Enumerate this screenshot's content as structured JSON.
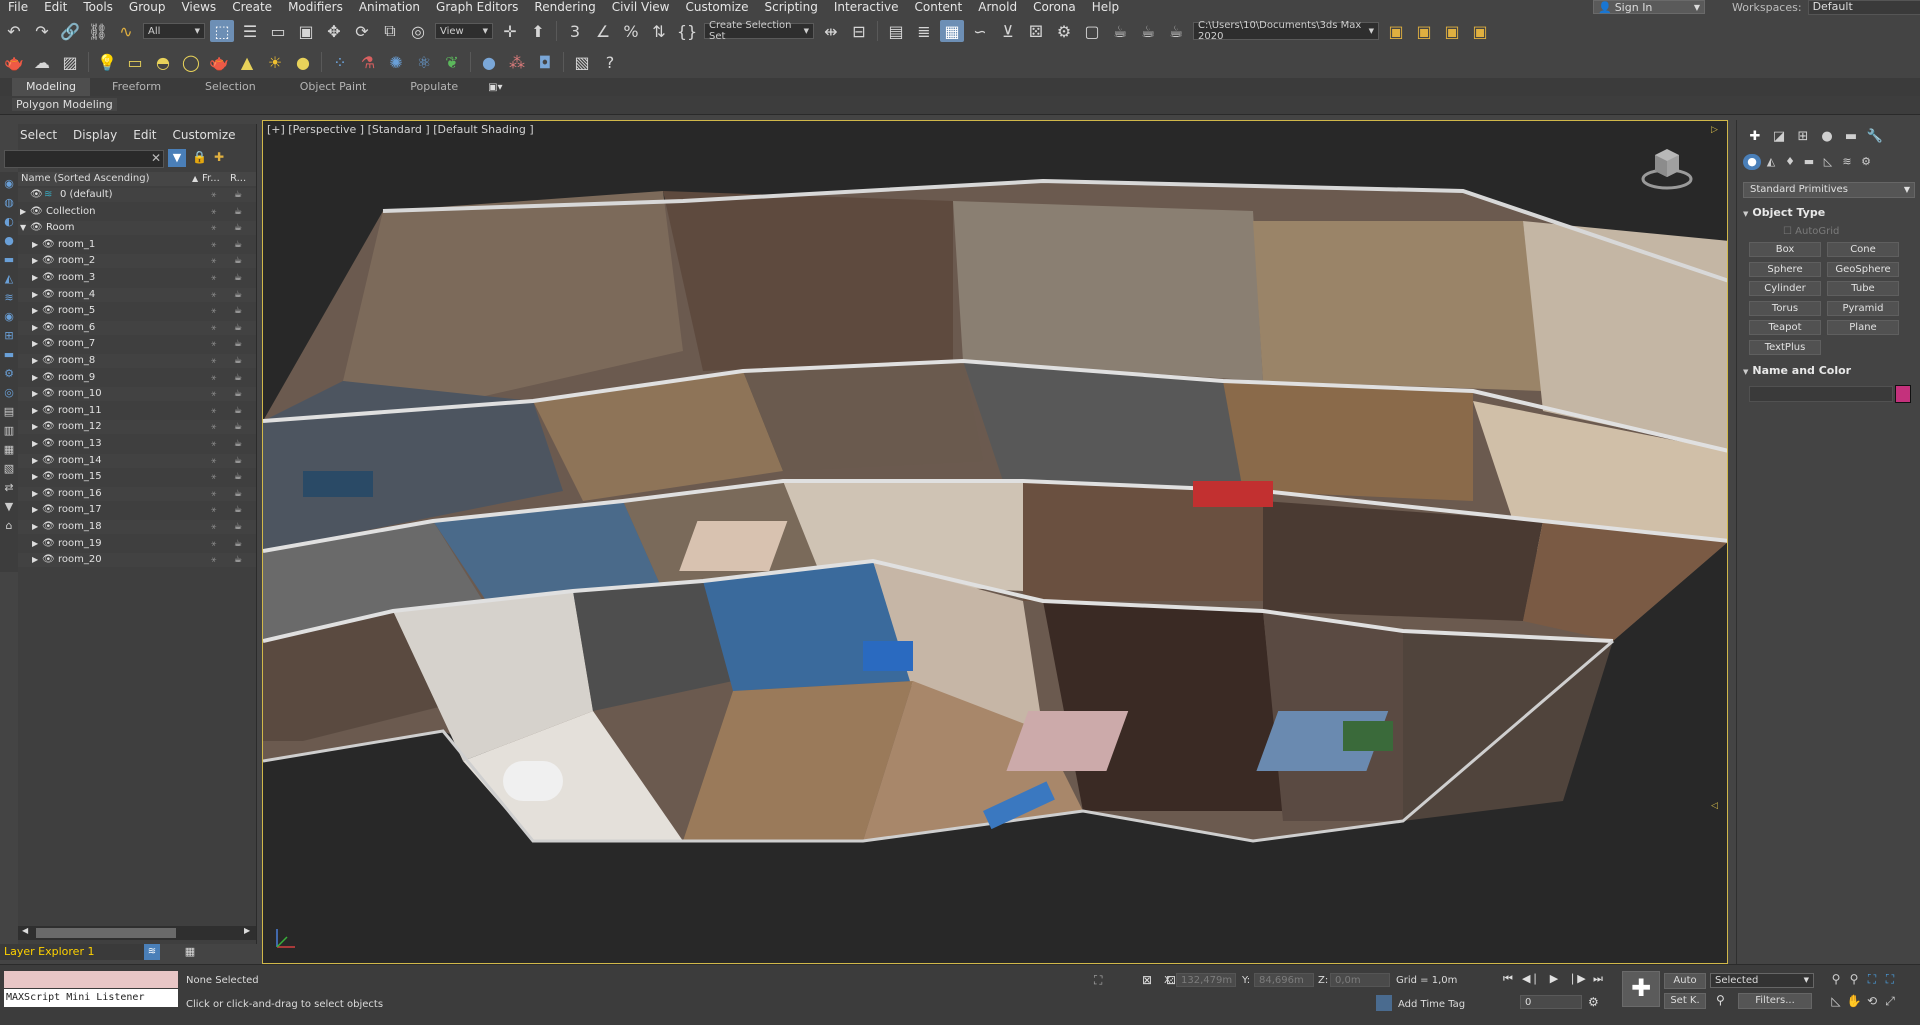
{
  "menubar": {
    "items": [
      "File",
      "Edit",
      "Tools",
      "Group",
      "Views",
      "Create",
      "Modifiers",
      "Animation",
      "Graph Editors",
      "Rendering",
      "Civil View",
      "Customize",
      "Scripting",
      "Interactive",
      "Content",
      "Arnold",
      "Corona",
      "Help"
    ],
    "sign_in": "Sign In",
    "workspaces_label": "Workspaces:",
    "workspaces_value": "Default"
  },
  "toolbar": {
    "filter_value": "All",
    "refcoord_value": "View",
    "selection_set_value": "Create Selection Set",
    "project_path": "C:\\Users\\10\\Documents\\3ds Max 2020"
  },
  "ribbon": {
    "tabs": [
      "Modeling",
      "Freeform",
      "Selection",
      "Object Paint",
      "Populate"
    ],
    "panel_label": "Polygon Modeling"
  },
  "explorer": {
    "menu": [
      "Select",
      "Display",
      "Edit",
      "Customize"
    ],
    "col_name": "Name (Sorted Ascending)",
    "col_frozen": "Fr...",
    "col_render": "R...",
    "rows": [
      {
        "name": "0 (default)",
        "level": 0,
        "expand": ""
      },
      {
        "name": "Collection",
        "level": 0,
        "expand": "▶"
      },
      {
        "name": "Room",
        "level": 0,
        "expand": "▼"
      },
      {
        "name": "room_1",
        "level": 1,
        "expand": "▶"
      },
      {
        "name": "room_2",
        "level": 1,
        "expand": "▶"
      },
      {
        "name": "room_3",
        "level": 1,
        "expand": "▶"
      },
      {
        "name": "room_4",
        "level": 1,
        "expand": "▶"
      },
      {
        "name": "room_5",
        "level": 1,
        "expand": "▶"
      },
      {
        "name": "room_6",
        "level": 1,
        "expand": "▶"
      },
      {
        "name": "room_7",
        "level": 1,
        "expand": "▶"
      },
      {
        "name": "room_8",
        "level": 1,
        "expand": "▶"
      },
      {
        "name": "room_9",
        "level": 1,
        "expand": "▶"
      },
      {
        "name": "room_10",
        "level": 1,
        "expand": "▶"
      },
      {
        "name": "room_11",
        "level": 1,
        "expand": "▶"
      },
      {
        "name": "room_12",
        "level": 1,
        "expand": "▶"
      },
      {
        "name": "room_13",
        "level": 1,
        "expand": "▶"
      },
      {
        "name": "room_14",
        "level": 1,
        "expand": "▶"
      },
      {
        "name": "room_15",
        "level": 1,
        "expand": "▶"
      },
      {
        "name": "room_16",
        "level": 1,
        "expand": "▶"
      },
      {
        "name": "room_17",
        "level": 1,
        "expand": "▶"
      },
      {
        "name": "room_18",
        "level": 1,
        "expand": "▶"
      },
      {
        "name": "room_19",
        "level": 1,
        "expand": "▶"
      },
      {
        "name": "room_20",
        "level": 1,
        "expand": "▶"
      }
    ]
  },
  "viewport": {
    "label": "[+] [Perspective ] [Standard ] [Default Shading ]"
  },
  "command_panel": {
    "category": "Standard Primitives",
    "object_type_title": "Object Type",
    "autogrid": "AutoGrid",
    "primitives": [
      "Box",
      "Cone",
      "Sphere",
      "GeoSphere",
      "Cylinder",
      "Tube",
      "Torus",
      "Pyramid",
      "Teapot",
      "Plane",
      "TextPlus"
    ],
    "name_color_title": "Name and Color",
    "object_color": "#c4317c"
  },
  "bottom": {
    "layer_explorer": "Layer Explorer 1",
    "listener_label": "MAXScript Mini Listener",
    "selection_status": "None Selected",
    "prompt": "Click or click-and-drag to select objects",
    "x_label": "X:",
    "x_value": "132,479m",
    "y_label": "Y:",
    "y_value": "84,696m",
    "z_label": "Z:",
    "z_value": "0,0m",
    "grid": "Grid = 1,0m",
    "add_time_tag": "Add Time Tag",
    "frame": "0",
    "auto": "Auto",
    "set_key": "Set K.",
    "selected": "Selected",
    "filters": "Filters..."
  }
}
